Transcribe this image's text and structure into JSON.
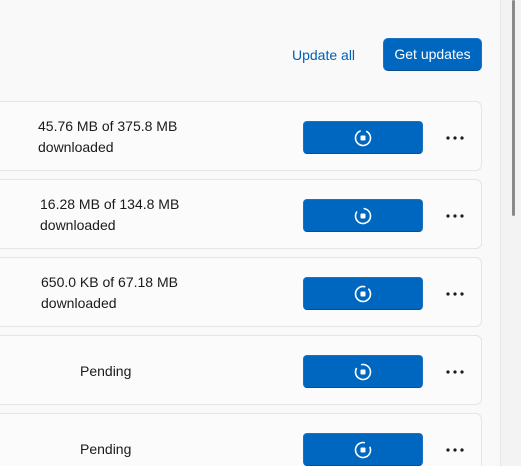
{
  "header": {
    "update_all_label": "Update all",
    "get_updates_label": "Get updates"
  },
  "rows": [
    {
      "status_line1": "45.76 MB of 375.8 MB",
      "status_line2": "downloaded"
    },
    {
      "status_line1": "16.28 MB of 134.8 MB",
      "status_line2": "downloaded"
    },
    {
      "status_line1": "650.0 KB of 67.18 MB",
      "status_line2": "downloaded"
    },
    {
      "status_line1": "Pending"
    },
    {
      "status_line1": "Pending"
    }
  ],
  "icons": {
    "progress": "stop-download-icon",
    "more": "more-options-icon"
  },
  "colors": {
    "accent": "#0067c0",
    "link": "#005fb8",
    "background": "#f9f9f9"
  }
}
